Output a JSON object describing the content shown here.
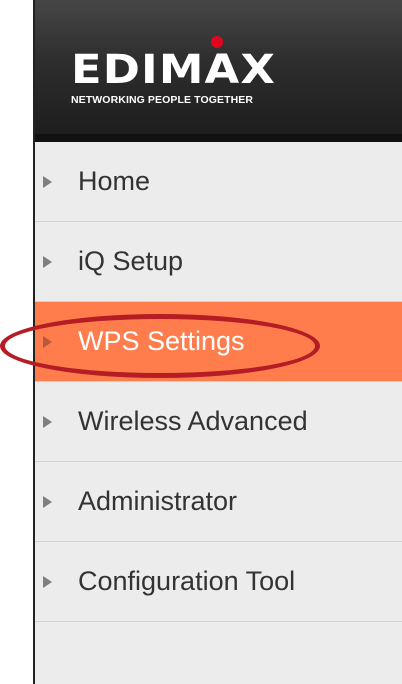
{
  "brand": {
    "name": "EDIMAX",
    "tagline": "NETWORKING PEOPLE TOGETHER",
    "accent_color": "#e0001b"
  },
  "menu": {
    "items": [
      {
        "label": "Home",
        "icon": "triangle-right-icon",
        "active": false
      },
      {
        "label": "iQ Setup",
        "icon": "triangle-right-icon",
        "active": false
      },
      {
        "label": "WPS Settings",
        "icon": "triangle-right-icon",
        "active": true
      },
      {
        "label": "Wireless Advanced",
        "icon": "triangle-right-icon",
        "active": false
      },
      {
        "label": "Administrator",
        "icon": "triangle-right-icon",
        "active": false
      },
      {
        "label": "Configuration Tool",
        "icon": "triangle-right-icon",
        "active": false
      }
    ],
    "active_color": "#ff7d4d"
  },
  "annotation": {
    "highlight_color": "#b51d24"
  }
}
